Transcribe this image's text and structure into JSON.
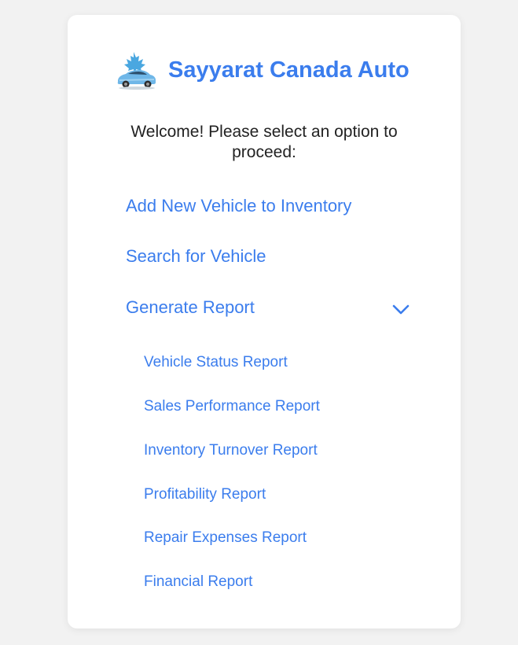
{
  "brand": {
    "name": "Sayyarat Canada Auto",
    "logo_icon": "maple-leaf-car-logo-icon",
    "accent_color": "#3b7ded"
  },
  "welcome_text": "Welcome! Please select an option to proceed:",
  "menu": {
    "add_vehicle": "Add New Vehicle to Inventory",
    "search_vehicle": "Search for Vehicle",
    "generate_report": "Generate Report",
    "expand_icon": "chevron-down-icon"
  },
  "reports": [
    "Vehicle Status Report",
    "Sales Performance Report",
    "Inventory Turnover Report",
    "Profitability Report",
    "Repair Expenses Report",
    "Financial Report"
  ]
}
